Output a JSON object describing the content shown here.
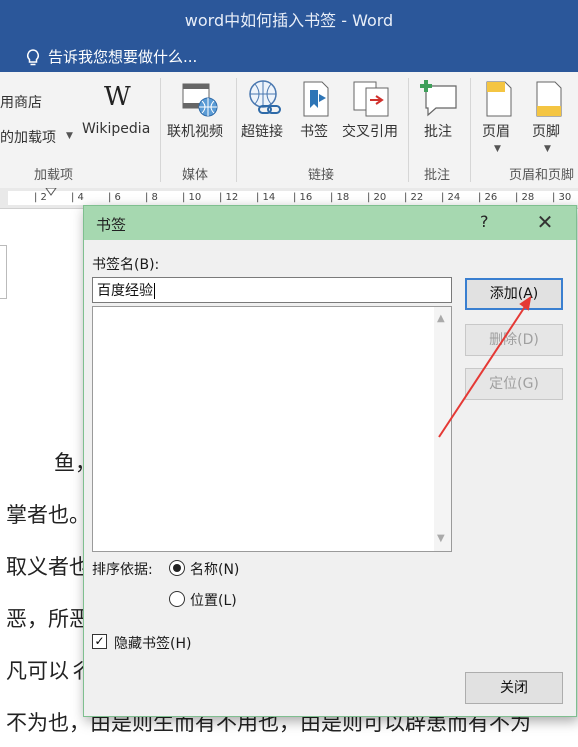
{
  "window": {
    "title": "word中如何插入书签 - Word"
  },
  "tell_me": {
    "text": "告诉我您想要做什么..."
  },
  "ribbon": {
    "addins": {
      "store": "用商店",
      "my_addins": "的加载项",
      "wikipedia": "Wikipedia",
      "group": "加载项"
    },
    "media": {
      "online_video": "联机视频",
      "group": "媒体"
    },
    "links": {
      "hyperlink": "超链接",
      "bookmark": "书签",
      "cross_reference": "交叉引用",
      "group": "链接"
    },
    "comments": {
      "comment": "批注",
      "group": "批注"
    },
    "header_footer": {
      "header": "页眉",
      "footer": "页脚",
      "group": "页眉和页脚"
    }
  },
  "ruler": {
    "ticks": [
      "2",
      "4",
      "6",
      "8",
      "10",
      "12",
      "14",
      "16",
      "18",
      "20",
      "22",
      "24",
      "26",
      "28",
      "30"
    ]
  },
  "document": {
    "lines": [
      "鱼，",
      "掌者也。",
      "取义者也",
      "恶，所恶",
      "凡可以彳",
      "不为也，由是则生而有不用也，由是则可以辟患而有不为"
    ]
  },
  "dialog": {
    "title": "书签",
    "help": "?",
    "name_label": "书签名(B):",
    "name_value": "百度经验",
    "buttons": {
      "add": "添加(A)",
      "delete": "删除(D)",
      "goto": "定位(G)",
      "close": "关闭"
    },
    "sort_label": "排序依据:",
    "sort_options": [
      {
        "label": "名称(N)",
        "selected": true
      },
      {
        "label": "位置(L)",
        "selected": false
      }
    ],
    "hidden_bookmarks": {
      "label": "隐藏书签(H)",
      "checked": true
    }
  },
  "colors": {
    "title_bar": "#2b579a",
    "dialog_title": "#a6d8b0",
    "annotation_arrow": "#e53935"
  }
}
